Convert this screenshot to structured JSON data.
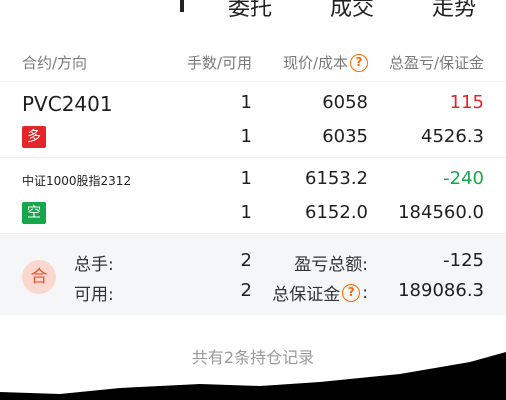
{
  "tabs": [
    {
      "label": "委托"
    },
    {
      "label": "成交"
    },
    {
      "label": "走势"
    }
  ],
  "header": {
    "contract": "合约/方向",
    "lots": "手数/可用",
    "price": "现价/成本",
    "pnl": "总盈亏/保证金",
    "help_icon": "?"
  },
  "positions": [
    {
      "name": "PVC2401",
      "direction": "多",
      "lots": "1",
      "available": "1",
      "price": "6058",
      "cost": "6035",
      "pnl": "115",
      "margin": "4526.3"
    },
    {
      "name": "中证1000股指2312",
      "direction": "空",
      "lots": "1",
      "available": "1",
      "price": "6153.2",
      "cost": "6152.0",
      "pnl": "-240",
      "margin": "184560.0"
    }
  ],
  "summary": {
    "icon_label": "合",
    "total_lots_label": "总手:",
    "total_lots": "2",
    "available_label": "可用:",
    "available": "2",
    "pnl_label": "盈亏总额:",
    "pnl": "-125",
    "margin_label": "总保证金",
    "margin_colon": ":",
    "margin": "189086.3"
  },
  "footer": {
    "note": "共有2条持仓记录"
  },
  "colors": {
    "profit": "#e4262b",
    "loss": "#16a64b",
    "accent": "#ff6a00"
  }
}
